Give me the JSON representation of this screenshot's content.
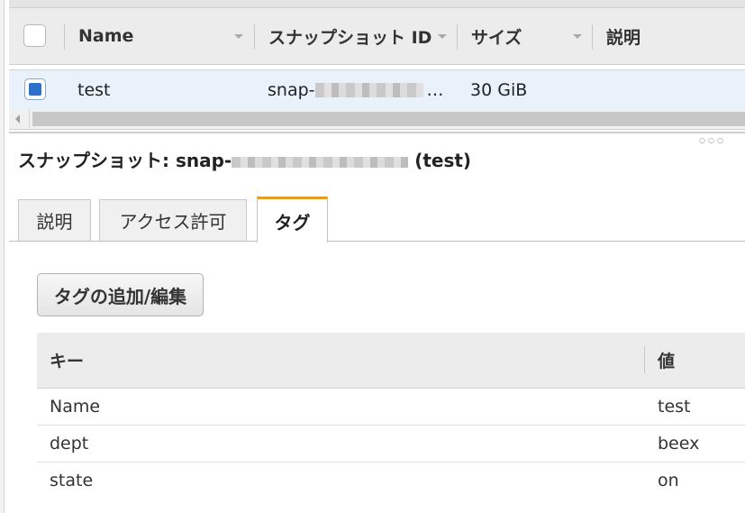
{
  "snapshot_table": {
    "columns": [
      {
        "label": "Name"
      },
      {
        "label": "スナップショット ID"
      },
      {
        "label": "サイズ"
      },
      {
        "label": "説明"
      }
    ],
    "rows": [
      {
        "name": "test",
        "snapshot_id_prefix": "snap-",
        "snapshot_id_suffix": "…",
        "size": "30 GiB",
        "description": "",
        "selected": true
      }
    ]
  },
  "details": {
    "title_prefix": "スナップショット: snap-",
    "title_suffix": "(test)",
    "tabs": [
      {
        "label": "説明",
        "active": false
      },
      {
        "label": "アクセス許可",
        "active": false
      },
      {
        "label": "タグ",
        "active": true
      }
    ],
    "edit_tags_button": "タグの追加/編集",
    "tags_table": {
      "key_header": "キー",
      "value_header": "値",
      "rows": [
        {
          "key": "Name",
          "value": "test"
        },
        {
          "key": "dept",
          "value": "beex"
        },
        {
          "key": "state",
          "value": "on"
        }
      ]
    }
  },
  "colors": {
    "selected_row_bg": "#e9f1fb",
    "checkbox_fill": "#2c70c9",
    "active_tab_accent": "#e89b26"
  }
}
